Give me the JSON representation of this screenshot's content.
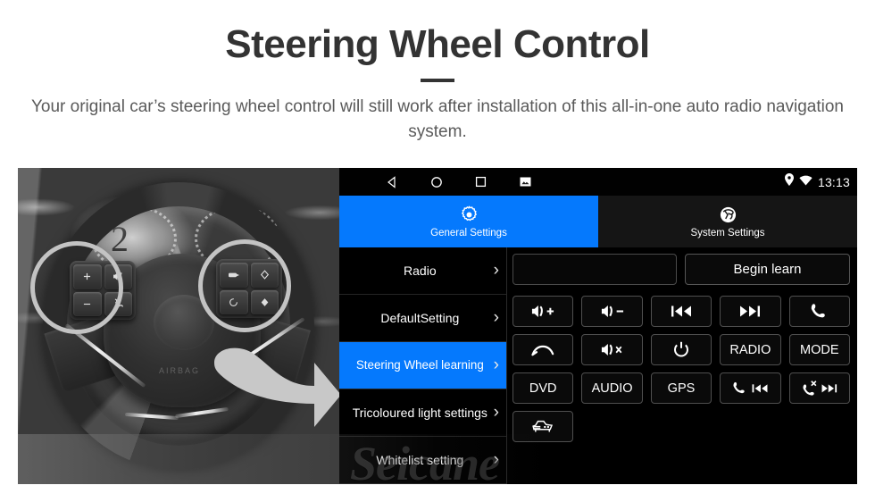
{
  "header": {
    "title": "Steering Wheel Control",
    "subtitle": "Your original car’s steering wheel control will still work after installation of this all-in-one auto radio navigation system."
  },
  "colors": {
    "accent_blue": "#0579fd",
    "highlight_yellow": "#f5c518",
    "title_dark": "#333333",
    "screen_black": "#000000"
  },
  "photo": {
    "alt_name": "steering-wheel-photo",
    "gauge_number": "2",
    "hub_text": "AIRBAG",
    "left_cluster_buttons": [
      "+",
      "voice-icon",
      "−",
      "phone-icon"
    ],
    "right_cluster_buttons": [
      "media-icon",
      "diamond-up-icon",
      "circle-icon",
      "diamond-down-icon"
    ],
    "highlight_circles": 2,
    "arrow": "right-arrow-icon"
  },
  "screen": {
    "statusbar": {
      "nav_icons": [
        "back-icon",
        "home-icon",
        "recents-icon",
        "screenshot-icon"
      ],
      "status_icons": [
        "location-pin-icon",
        "wifi-icon"
      ],
      "clock": "13:13"
    },
    "tabs": [
      {
        "label": "General Settings",
        "icon": "gear-icon",
        "active": true
      },
      {
        "label": "System Settings",
        "icon": "system-logo-icon",
        "active": false
      }
    ],
    "sidebar": {
      "items": [
        {
          "label": "Radio",
          "active": false,
          "chevron": "›"
        },
        {
          "label": "DefaultSetting",
          "active": false,
          "chevron": "›"
        },
        {
          "label": "Steering Wheel learning",
          "active": true,
          "chevron": "›"
        },
        {
          "label": "Tricoloured light settings",
          "active": false,
          "chevron": "›"
        },
        {
          "label": "Whitelist setting",
          "active": false,
          "chevron": "›"
        }
      ]
    },
    "pane": {
      "learn_display_value": "",
      "learn_display_placeholder": "",
      "begin_learn_label": "Begin learn",
      "buttons": [
        {
          "label": "",
          "icon": "volume-up-icon"
        },
        {
          "label": "",
          "icon": "volume-down-icon"
        },
        {
          "label": "",
          "icon": "previous-track-icon"
        },
        {
          "label": "",
          "icon": "next-track-icon"
        },
        {
          "label": "",
          "icon": "phone-answer-icon"
        },
        {
          "label": "",
          "icon": "phone-hangup-icon"
        },
        {
          "label": "",
          "icon": "volume-mute-icon"
        },
        {
          "label": "",
          "icon": "power-icon"
        },
        {
          "label": "RADIO",
          "icon": ""
        },
        {
          "label": "MODE",
          "icon": ""
        },
        {
          "label": "DVD",
          "icon": ""
        },
        {
          "label": "AUDIO",
          "icon": ""
        },
        {
          "label": "GPS",
          "icon": ""
        },
        {
          "label": "",
          "icon": "phone-previous-icon"
        },
        {
          "label": "",
          "icon": "phone-reject-next-icon"
        },
        {
          "label": "",
          "icon": "car-settings-icon"
        }
      ]
    }
  },
  "watermark": {
    "text": "Seicane"
  }
}
